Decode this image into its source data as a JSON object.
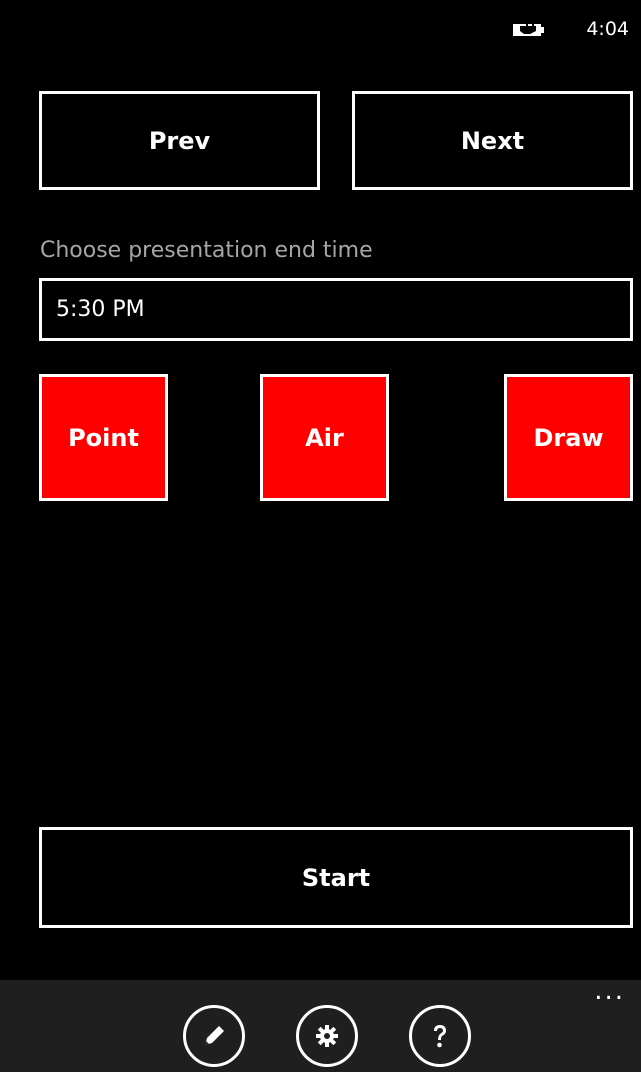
{
  "status_bar": {
    "time": "4:04",
    "battery_icon": "battery-charging-icon"
  },
  "nav": {
    "prev_label": "Prev",
    "next_label": "Next"
  },
  "end_time": {
    "label": "Choose presentation end time",
    "value": "5:30 PM"
  },
  "modes": [
    {
      "label": "Point"
    },
    {
      "label": "Air"
    },
    {
      "label": "Draw"
    }
  ],
  "start_label": "Start",
  "app_bar": {
    "icons": [
      "edit-icon",
      "settings-icon",
      "help-icon"
    ],
    "more_label": "..."
  },
  "colors": {
    "accent": "#ff0000",
    "background": "#000000",
    "appbar": "#1f1f1f",
    "label": "#a6a6a6"
  }
}
